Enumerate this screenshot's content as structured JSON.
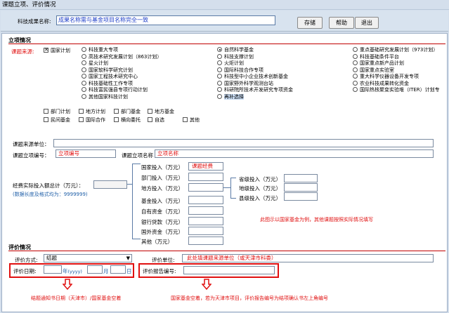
{
  "window": {
    "title": "课题立项、评价情况"
  },
  "top": {
    "name_label": "科技成果名称:",
    "name_value": "成果名称需与基金项目名称完全一致",
    "buttons": {
      "save": "存储",
      "help": "帮助",
      "exit": "退出"
    }
  },
  "project": {
    "section_title": "立项情况",
    "source_label": "课题来源:",
    "national_plan": "国家计划",
    "col1": [
      "科技重大专项",
      "高技术研究发展计划（863计划）",
      "星火计划",
      "国家软科学研究计划",
      "国家工程技术研究中心",
      "科技基础性工作专项",
      "科技富民强县专项行动计划",
      "其他国家科技计划"
    ],
    "col2": [
      "自然科学基金",
      "科技支撑计划",
      "火炬计划",
      "国际科技合作专项",
      "科技型中小企业技术创新基金",
      "国家野外科学观测台站",
      "科研院所技术开发研究专项资金",
      "再补选择"
    ],
    "col3": [
      "重点基础研究发展计划（973计划）",
      "科技基础条件平台",
      "国家重点新产品计划",
      "国家重点实验室",
      "重大科学仪器设备开发专项",
      "农业科技成果转化资金",
      "国际热核聚变实验堆（ITER）计划专"
    ],
    "other_row1": [
      "部门计划",
      "地方计划",
      "部门基金",
      "地方基金"
    ],
    "other_row2": [
      "民间基金",
      "国际合作",
      "横向委托",
      "自选",
      "其他"
    ],
    "source_unit_label": "课题来源单位：",
    "project_no_label": "课题立项编号：",
    "project_no_value": "立项编号",
    "project_name_label": "课题立项名称",
    "project_name_value": "立项名称",
    "total_invest_label": "经费实际投入额总计（万元）：",
    "data_length_hint": "(数据长度及格式均为：9999999)",
    "national_invest": "国家投入（万元）",
    "national_invest_value": "课题经费",
    "dept_invest": "部门投入（万元）",
    "local_invest": "地方投入（万元）",
    "provincial_invest": "省级投入（万元）",
    "city_invest": "地级投入（万元）",
    "county_invest": "县级投入（万元）",
    "fund_invest": "基金投入（万元）",
    "self_funds": "自有资金（万元）",
    "bank_loan": "银行贷款（万元）",
    "foreign_funds": "国外资金（万元）",
    "other_funds": "其他（万元）",
    "annotation": "此图示以国家基金为例，其他课题按照实际情况填写"
  },
  "evaluation": {
    "section_title": "评价情况",
    "method_label": "评价方式:",
    "method_value": "结题",
    "unit_label": "评价单位:",
    "unit_value": "此处填课题来源单位（或天津市科委）",
    "date_label": "评价日期:",
    "year_suffix": "年",
    "yyyy": "(yyyy)",
    "month_suffix": "月",
    "day_suffix": "日",
    "report_no_label": "评价报告编号:",
    "note_left": "结题通知书日期（天津市）/国家基金空着",
    "note_right": "国家基金空着，若为天津市项目，评价报告编号为结项确认书左上角编号"
  }
}
